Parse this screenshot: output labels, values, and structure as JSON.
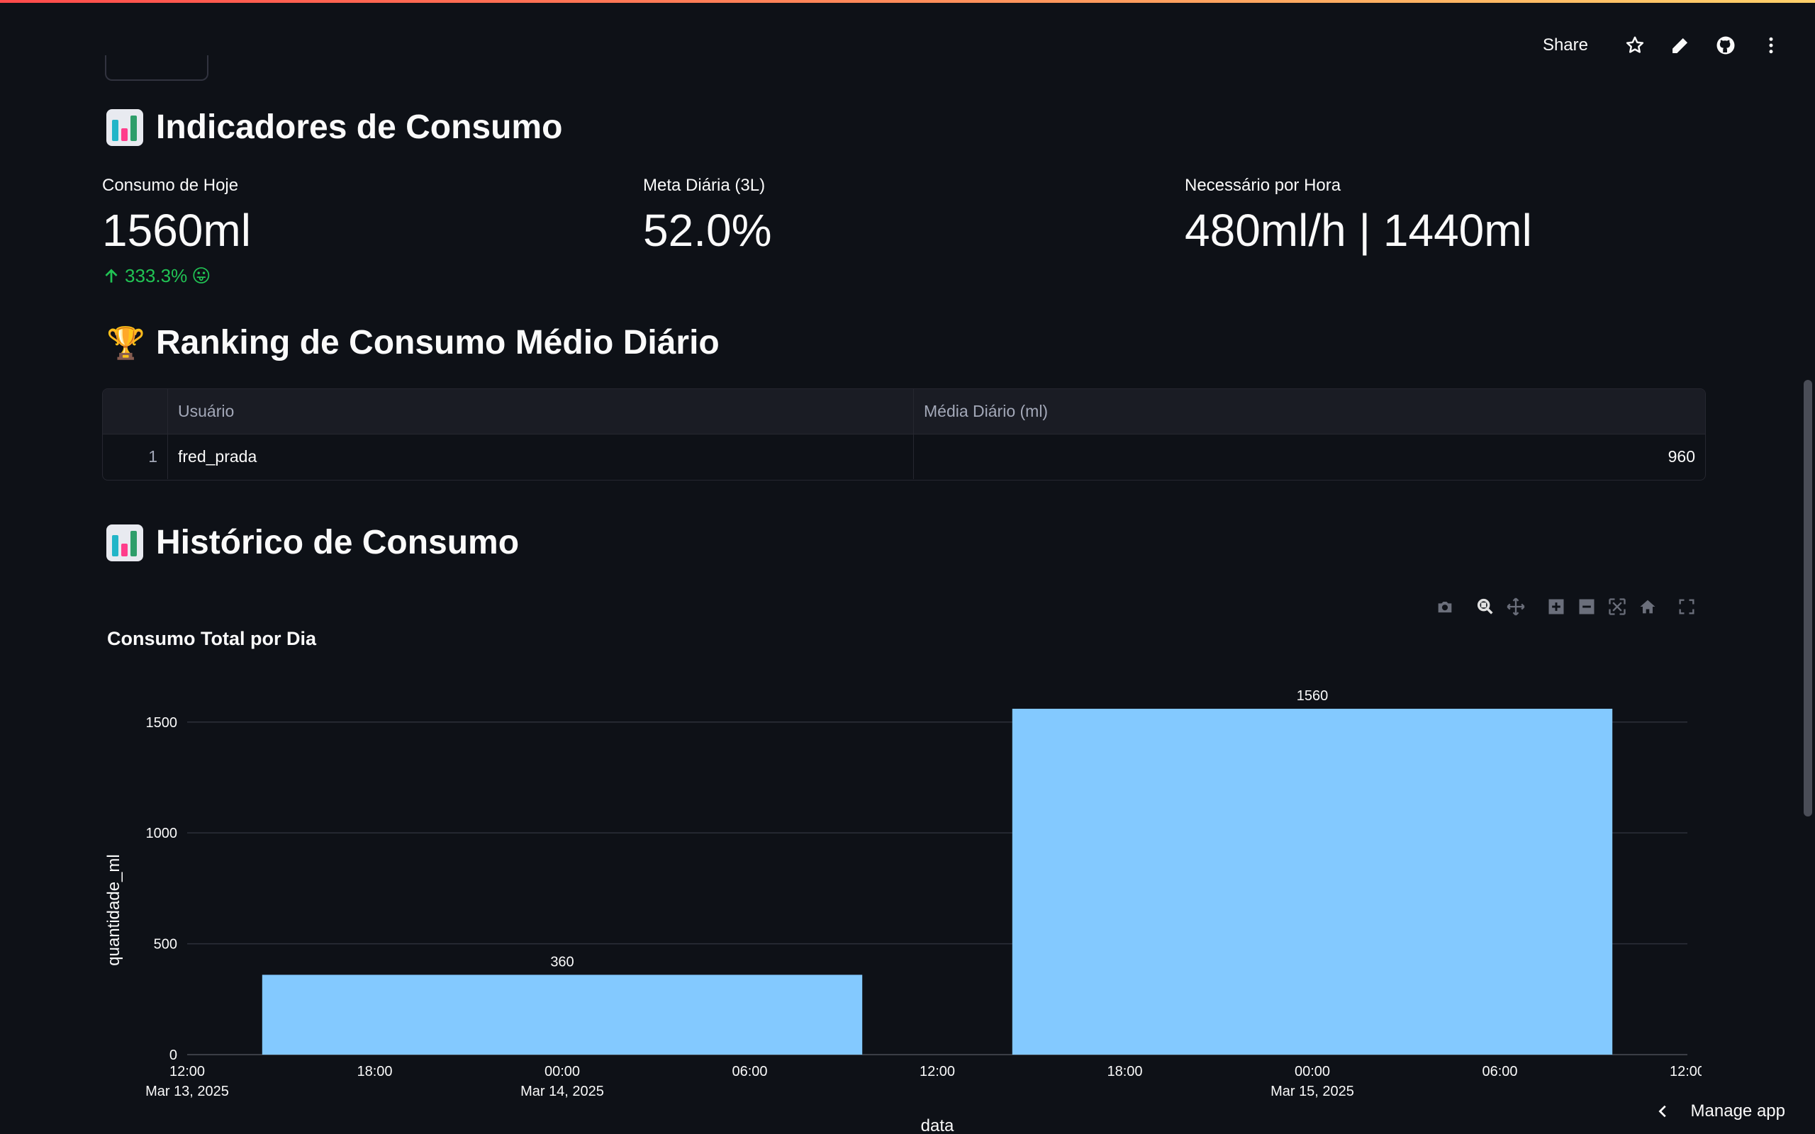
{
  "header": {
    "share_label": "Share",
    "icons": [
      "star-icon",
      "edit-icon",
      "github-icon",
      "more-vertical-icon"
    ]
  },
  "sections": {
    "indicators_title": "Indicadores de Consumo",
    "ranking_title": "Ranking de Consumo Médio Diário",
    "history_title": "Histórico de Consumo"
  },
  "metrics": [
    {
      "label": "Consumo de Hoje",
      "value": "1560ml",
      "delta": "333.3%",
      "delta_emoji": "😛"
    },
    {
      "label": "Meta Diária (3L)",
      "value": "52.0%"
    },
    {
      "label": "Necessário por Hora",
      "value": "480ml/h | 1440ml"
    }
  ],
  "ranking_table": {
    "columns": [
      "Usuário",
      "Média Diário (ml)"
    ],
    "rows": [
      {
        "index": "1",
        "user": "fred_prada",
        "avg": "960"
      }
    ]
  },
  "chart_data": {
    "type": "bar",
    "title": "Consumo Total por Dia",
    "xlabel": "data",
    "ylabel": "quantidade_ml",
    "categories": [
      "Mar 14, 2025",
      "Mar 15, 2025"
    ],
    "values": [
      360,
      1560
    ],
    "ylim": [
      0,
      1560
    ],
    "yticks": [
      0,
      500,
      1000,
      1500
    ],
    "xticks": [
      {
        "line1": "12:00",
        "line2": "Mar 13, 2025"
      },
      {
        "line1": "18:00",
        "line2": ""
      },
      {
        "line1": "00:00",
        "line2": "Mar 14, 2025"
      },
      {
        "line1": "06:00",
        "line2": ""
      },
      {
        "line1": "12:00",
        "line2": ""
      },
      {
        "line1": "18:00",
        "line2": ""
      },
      {
        "line1": "00:00",
        "line2": "Mar 15, 2025"
      },
      {
        "line1": "06:00",
        "line2": ""
      },
      {
        "line1": "12:00",
        "line2": ""
      }
    ],
    "bar_color": "#83c9ff",
    "grid": true
  },
  "footer": {
    "manage_label": "Manage app"
  },
  "colors": {
    "background": "#0e1117",
    "delta_positive": "#21c354",
    "bar": "#83c9ff"
  }
}
